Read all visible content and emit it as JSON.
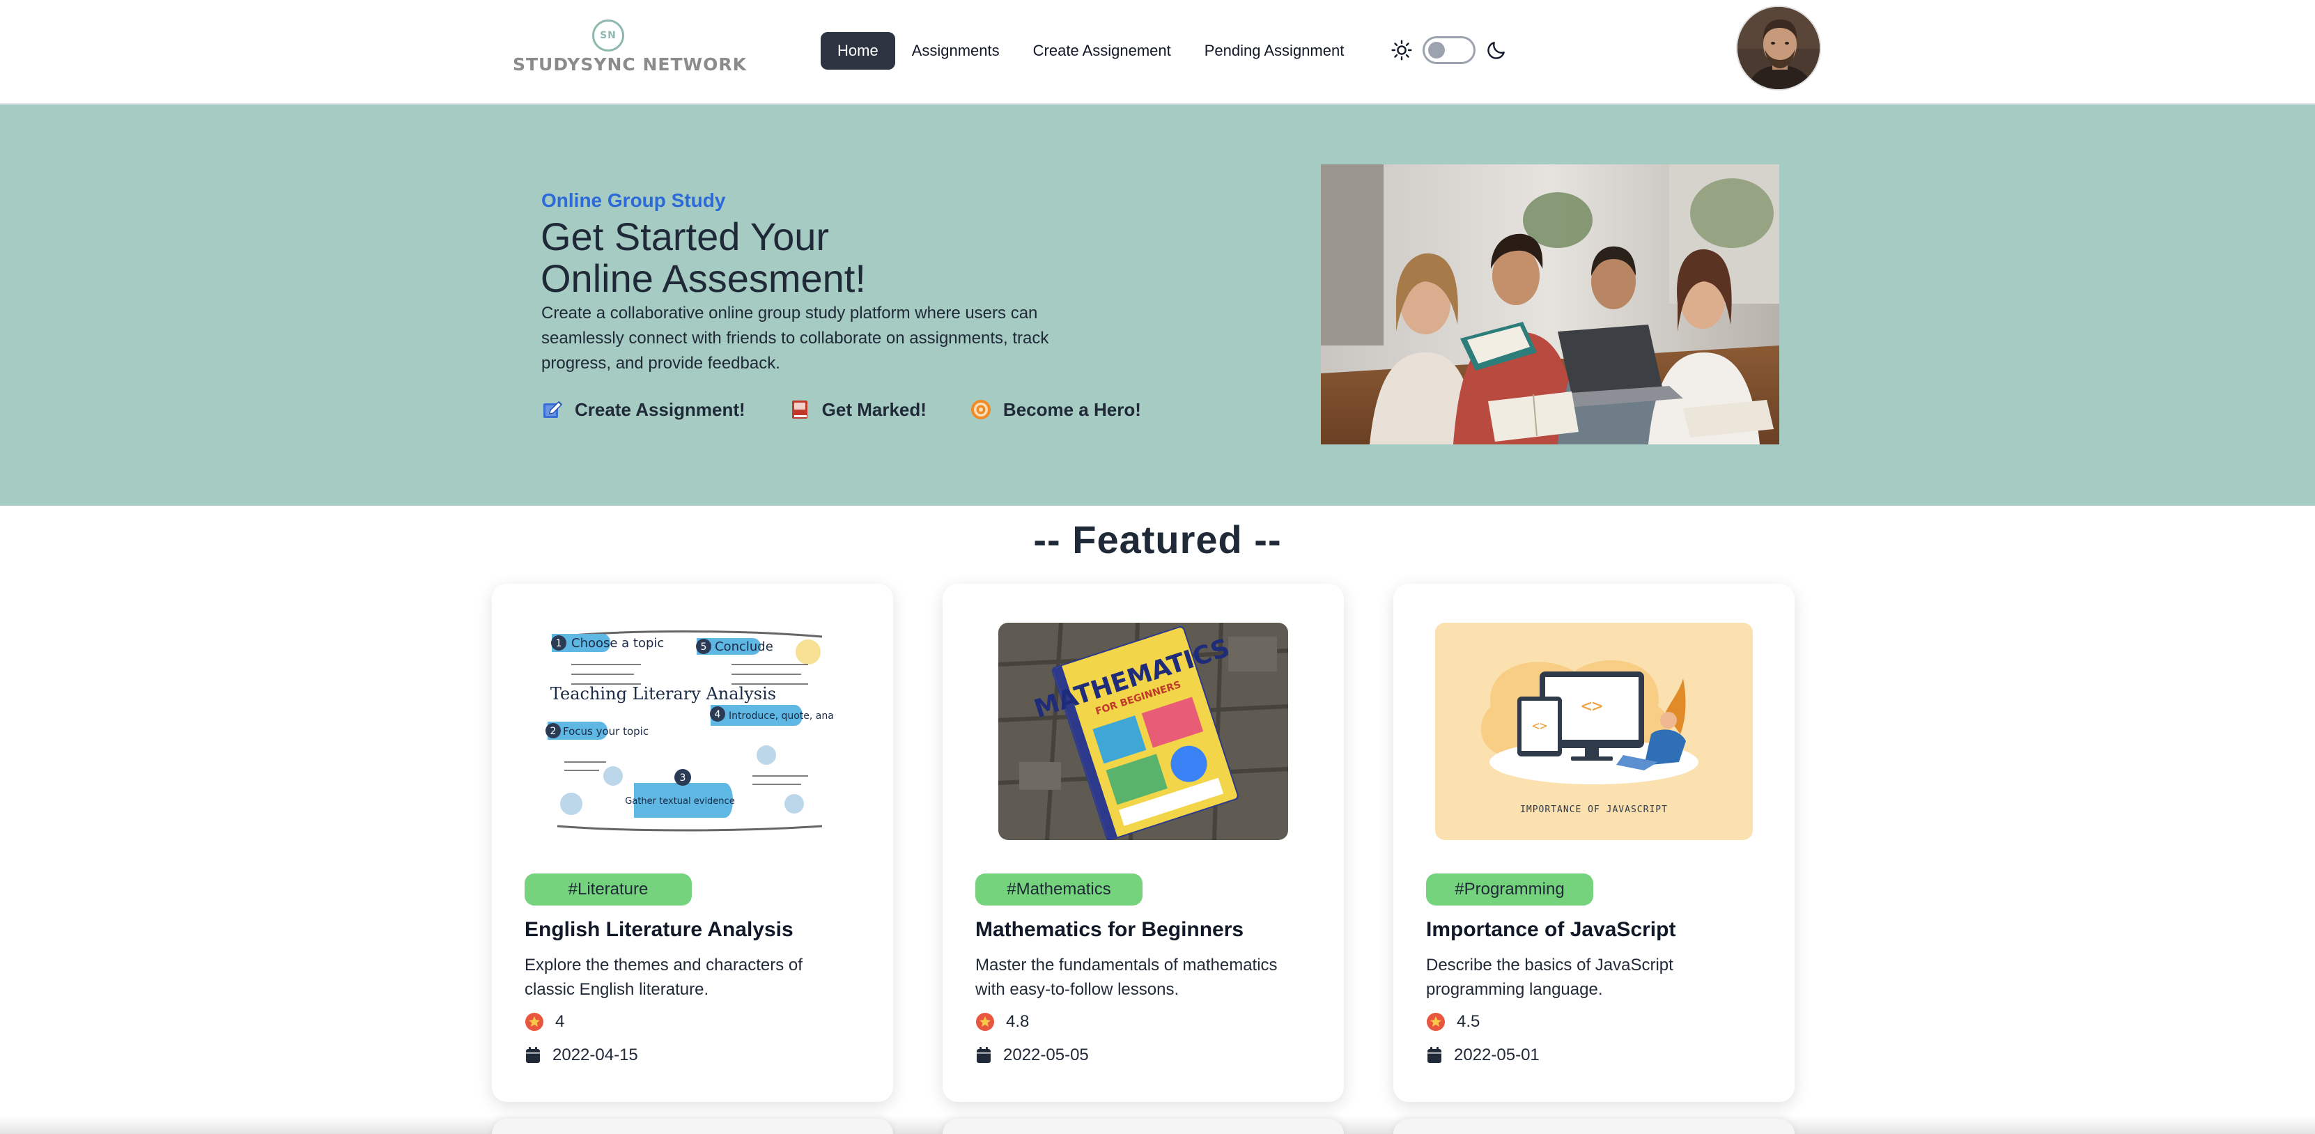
{
  "brand": {
    "logo_mark": "SN",
    "logo_text": "STUDYSYNC NETWORK"
  },
  "nav": {
    "items": [
      {
        "label": "Home",
        "active": true
      },
      {
        "label": "Assignments",
        "active": false
      },
      {
        "label": "Create Assignement",
        "active": false
      },
      {
        "label": "Pending Assignment",
        "active": false
      }
    ],
    "theme": {
      "light_icon": "sun-icon",
      "dark_icon": "moon-icon",
      "mode": "light"
    }
  },
  "hero": {
    "eyebrow": "Online Group Study",
    "title_line1": "Get Started Your",
    "title_line2": "Online Assesment!",
    "description": "Create a collaborative online group study platform where users can seamlessly connect with friends to collaborate on assignments, track progress, and provide feedback.",
    "actions": [
      {
        "label": "Create Assignment!",
        "icon": "edit-note-icon"
      },
      {
        "label": "Get Marked!",
        "icon": "book-icon"
      },
      {
        "label": "Become a Hero!",
        "icon": "target-icon"
      }
    ]
  },
  "featured": {
    "heading": "-- Featured --",
    "cards": [
      {
        "tag": "#Literature",
        "title": "English Literature Analysis",
        "description": "Explore the themes and characters of classic English literature.",
        "rating": "4",
        "date": "2022-04-15"
      },
      {
        "tag": "#Mathematics",
        "title": "Mathematics for Beginners",
        "description": "Master the fundamentals of mathematics with easy-to-follow lessons.",
        "rating": "4.8",
        "date": "2022-05-05"
      },
      {
        "tag": "#Programming",
        "title": "Importance of JavaScript",
        "description": "Describe the basics of JavaScript programming language.",
        "rating": "4.5",
        "date": "2022-05-01"
      }
    ]
  },
  "images": {
    "literature_words": [
      "Choose a topic",
      "Conclude",
      "Focus your topic",
      "Teaching Literary Analysis",
      "Introduce, quote, analyze",
      "Gather textual evidence"
    ],
    "math_book_title": "MATHEMATICS",
    "math_book_subtitle": "FOR BEGINNERS",
    "js_caption": "IMPORTANCE OF JAVASCRIPT"
  },
  "colors": {
    "hero_bg": "#a6cbc2",
    "accent_blue": "#2b6ad8",
    "tag_green": "#75d37d",
    "nav_active": "#2b3440"
  }
}
